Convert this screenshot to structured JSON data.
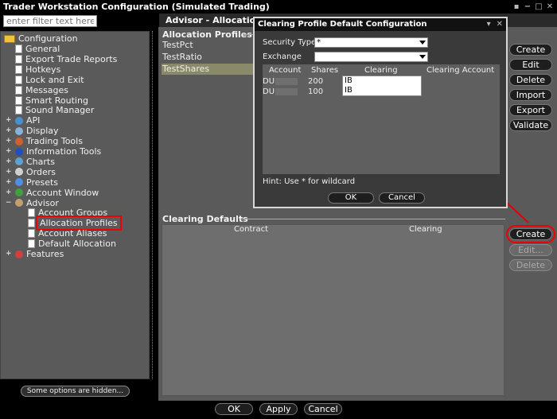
{
  "window": {
    "title": "Trader Workstation Configuration (Simulated Trading)"
  },
  "filter": {
    "placeholder": "enter filter text here"
  },
  "tree": {
    "root": "Configuration",
    "items": [
      {
        "label": "General",
        "level": 1,
        "icon": "doc"
      },
      {
        "label": "Export Trade Reports",
        "level": 1,
        "icon": "doc"
      },
      {
        "label": "Hotkeys",
        "level": 1,
        "icon": "doc"
      },
      {
        "label": "Lock and Exit",
        "level": 1,
        "icon": "doc"
      },
      {
        "label": "Messages",
        "level": 1,
        "icon": "doc"
      },
      {
        "label": "Smart Routing",
        "level": 1,
        "icon": "doc"
      },
      {
        "label": "Sound Manager",
        "level": 1,
        "icon": "doc"
      },
      {
        "label": "API",
        "level": 1,
        "icon": "api"
      },
      {
        "label": "Display",
        "level": 1,
        "icon": "display"
      },
      {
        "label": "Trading Tools",
        "level": 1,
        "icon": "tools"
      },
      {
        "label": "Information Tools",
        "level": 1,
        "icon": "info"
      },
      {
        "label": "Charts",
        "level": 1,
        "icon": "chart"
      },
      {
        "label": "Orders",
        "level": 1,
        "icon": "orders"
      },
      {
        "label": "Presets",
        "level": 1,
        "icon": "presets"
      },
      {
        "label": "Account Window",
        "level": 1,
        "icon": "account"
      },
      {
        "label": "Advisor",
        "level": 1,
        "icon": "advisor"
      },
      {
        "label": "Account Groups",
        "level": 2,
        "icon": "doc"
      },
      {
        "label": "Allocation Profiles",
        "level": 2,
        "icon": "doc"
      },
      {
        "label": "Account Aliases",
        "level": 2,
        "icon": "doc"
      },
      {
        "label": "Default Allocation",
        "level": 2,
        "icon": "doc"
      },
      {
        "label": "Features",
        "level": 1,
        "icon": "features"
      }
    ],
    "hidden_options": "Some options are hidden..."
  },
  "panel": {
    "header": "Advisor - Allocation P",
    "profiles_label": "Allocation Profiles",
    "profiles": [
      "TestPct",
      "TestRatio",
      "TestShares"
    ],
    "buttons": [
      "Create",
      "Edit",
      "Delete",
      "Import",
      "Export",
      "Validate"
    ],
    "clearing_label": "Clearing Defaults",
    "clearing_columns": [
      "Contract",
      "Clearing"
    ],
    "clearing_buttons": [
      "Create",
      "Edit...",
      "Delete"
    ]
  },
  "footer": {
    "ok": "OK",
    "apply": "Apply",
    "cancel": "Cancel"
  },
  "dialog": {
    "title": "Clearing Profile Default Configuration",
    "security_type_label": "Security Type",
    "security_type_value": "*",
    "exchange_label": "Exchange",
    "exchange_value": "",
    "columns": [
      "Account",
      "Shares",
      "Clearing",
      "Clearing Account"
    ],
    "rows": [
      {
        "account": "DU",
        "shares": "200",
        "clearing": "IB"
      },
      {
        "account": "DU",
        "shares": "100",
        "clearing": "IB"
      }
    ],
    "hint": "Hint: Use * for wildcard",
    "ok": "OK",
    "cancel": "Cancel"
  },
  "colors": {
    "accent_red": "#e00000",
    "selection": "#8a8a6a"
  }
}
